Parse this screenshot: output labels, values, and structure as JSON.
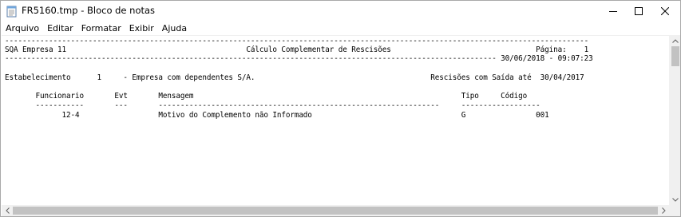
{
  "window": {
    "title": "FR5160.tmp - Bloco de notas"
  },
  "menu": {
    "items": [
      {
        "label": "Arquivo"
      },
      {
        "label": "Editar"
      },
      {
        "label": "Formatar"
      },
      {
        "label": "Exibir"
      },
      {
        "label": "Ajuda"
      }
    ]
  },
  "document": {
    "lines": [
      "-------------------------------------------------------------------------------------------------------------------------------------",
      "SQA Empresa 11                                         Cálculo Complementar de Rescisões                                 Página:    1",
      "---------------------------------------------------------------------------------------------------------------- 30/06/2018 - 09:07:23",
      "",
      "Estabelecimento      1     - Empresa com dependentes S/A.                                        Rescisões com Saída até  30/04/2017",
      "",
      "       Funcionario       Evt       Mensagem                                                             Tipo     Código",
      "       -----------       ---       ----------------------------------------------------------------     ------------------",
      "             12-4                  Motivo do Complemento não Informado                                  G                001"
    ]
  }
}
